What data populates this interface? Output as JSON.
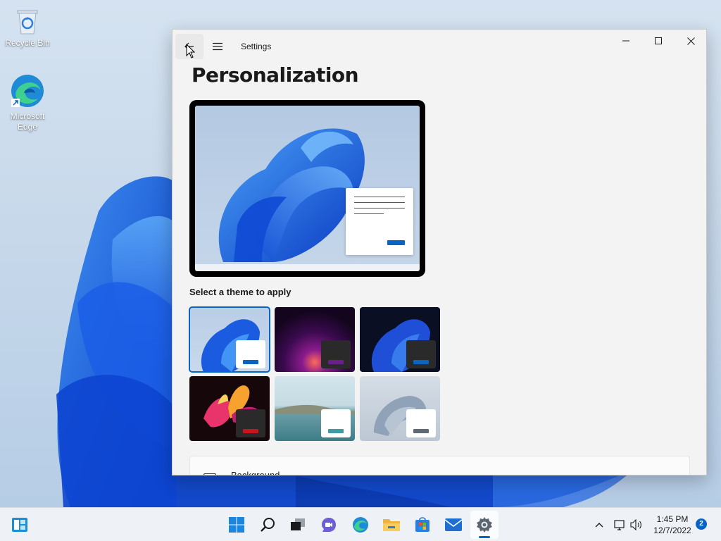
{
  "desktop": {
    "icons": [
      {
        "label": "Recycle Bin",
        "icon": "recycle-bin-icon"
      },
      {
        "label": "Microsoft\nEdge",
        "icon": "edge-icon"
      }
    ]
  },
  "window": {
    "title": "Settings",
    "back_icon": "back-arrow-icon",
    "menu_icon": "hamburger-menu-icon",
    "controls": [
      "minimize",
      "maximize",
      "close"
    ],
    "page_title": "Personalization",
    "theme_section_label": "Select a theme to apply",
    "themes": [
      {
        "name": "windows-light",
        "selected": true,
        "accent": "#0a64c4"
      },
      {
        "name": "windows-glow",
        "selected": false,
        "accent": "#6a1f8a"
      },
      {
        "name": "windows-dark",
        "selected": false,
        "accent": "#0a64c4"
      },
      {
        "name": "captured-motion",
        "selected": false,
        "accent": "#c8141e"
      },
      {
        "name": "sunrise-lake",
        "selected": false,
        "accent": "#3e9aa3"
      },
      {
        "name": "flow",
        "selected": false,
        "accent": "#5f6a75"
      }
    ],
    "next_card_label": "Background"
  },
  "taskbar": {
    "icons": [
      "widgets-icon",
      "start-icon",
      "search-icon",
      "task-view-icon",
      "chat-icon",
      "edge-icon",
      "file-explorer-icon",
      "store-icon",
      "mail-icon",
      "settings-icon"
    ],
    "tray_icons": [
      "chevron-up-icon",
      "network-icon",
      "volume-icon"
    ],
    "time": "1:45 PM",
    "date": "12/7/2022",
    "notification_count": "2"
  },
  "colors": {
    "accent": "#0a64c4",
    "window_bg": "#f3f3f3",
    "taskbar_bg": "#eef2f7"
  }
}
